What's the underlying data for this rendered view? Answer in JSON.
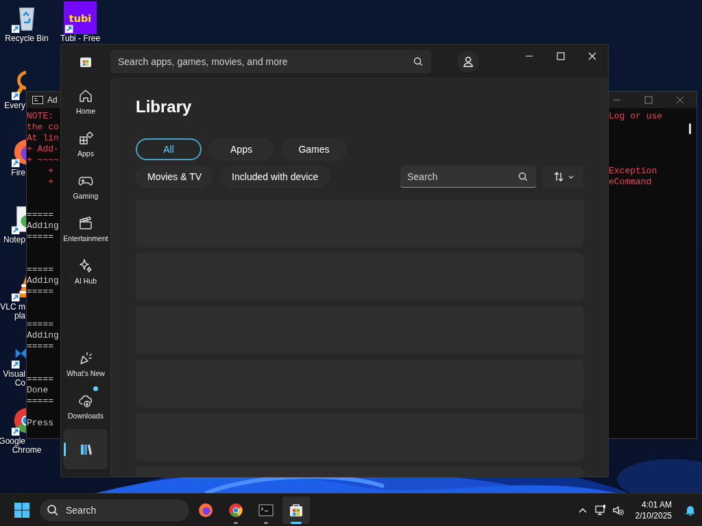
{
  "desktop_icons": [
    {
      "kind": "recycle",
      "label_lines": [
        "Recycle Bin"
      ]
    },
    {
      "kind": "everything",
      "label_lines": [
        "Every"
      ]
    },
    {
      "kind": "firefox",
      "label_lines": [
        "Fire"
      ]
    },
    {
      "kind": "notepad",
      "label_lines": [
        "Notep"
      ]
    },
    {
      "kind": "vlc",
      "label_lines": [
        "VLC m",
        "pla"
      ]
    },
    {
      "kind": "vscode",
      "label_lines": [
        "Visual",
        "Co"
      ]
    },
    {
      "kind": "chrome",
      "label_lines": [
        "Google",
        "Chrome"
      ]
    },
    {
      "kind": "tubi",
      "logo_text": "tubi",
      "label_lines": [
        "Tubi - Free"
      ]
    }
  ],
  "terminal": {
    "title": "Ad",
    "lines": [
      {
        "kind": "error",
        "left": "NOTE:",
        "right": "Log or use"
      },
      {
        "kind": "error",
        "left": "the co"
      },
      {
        "kind": "error",
        "left": "At lin"
      },
      {
        "kind": "error",
        "left": "+ Add-"
      },
      {
        "kind": "error",
        "left": "+ ~~~~"
      },
      {
        "kind": "error",
        "left": "    +",
        "right": "Exception"
      },
      {
        "kind": "error",
        "left": "    +",
        "right": "eCommand"
      },
      {
        "kind": "blank"
      },
      {
        "kind": "blank"
      },
      {
        "kind": "output",
        "left": "====="
      },
      {
        "kind": "output",
        "left": "Adding"
      },
      {
        "kind": "output",
        "left": "====="
      },
      {
        "kind": "blank"
      },
      {
        "kind": "blank"
      },
      {
        "kind": "output",
        "left": "====="
      },
      {
        "kind": "output",
        "left": "Adding"
      },
      {
        "kind": "output",
        "left": "====="
      },
      {
        "kind": "blank"
      },
      {
        "kind": "blank"
      },
      {
        "kind": "output",
        "left": "====="
      },
      {
        "kind": "output",
        "left": "Adding"
      },
      {
        "kind": "output",
        "left": "====="
      },
      {
        "kind": "blank"
      },
      {
        "kind": "blank"
      },
      {
        "kind": "output",
        "left": "====="
      },
      {
        "kind": "output",
        "left": "Done"
      },
      {
        "kind": "output",
        "left": "====="
      },
      {
        "kind": "blank"
      },
      {
        "kind": "output",
        "left": "Press"
      }
    ]
  },
  "store": {
    "search": {
      "placeholder": "Search apps, games, movies, and more"
    },
    "sidebar": {
      "items": [
        {
          "kind": "home",
          "label": "Home",
          "selected": false,
          "badge": false
        },
        {
          "kind": "apps",
          "label": "Apps",
          "selected": false,
          "badge": false
        },
        {
          "kind": "gaming",
          "label": "Gaming",
          "selected": false,
          "badge": false
        },
        {
          "kind": "entertainment",
          "label": "Entertainment",
          "selected": false,
          "badge": false
        },
        {
          "kind": "ai",
          "label": "AI Hub",
          "selected": false,
          "badge": false
        },
        {
          "kind": "whatsnew",
          "label": "What's New",
          "selected": false,
          "badge": false
        },
        {
          "kind": "downloads",
          "label": "Downloads",
          "selected": false,
          "badge": true
        },
        {
          "kind": "library",
          "selected": true,
          "badge": false
        }
      ]
    },
    "heading": "Library",
    "filters": [
      {
        "label": "All",
        "selected": true
      },
      {
        "label": "Apps",
        "selected": false
      },
      {
        "label": "Games",
        "selected": false
      },
      {
        "label": "Movies & TV",
        "selected": false
      },
      {
        "label": "Included with device",
        "selected": false
      }
    ],
    "library_search": {
      "placeholder": "Search"
    },
    "cards": [
      {
        "kind": "placeholder"
      },
      {
        "kind": "placeholder"
      },
      {
        "kind": "placeholder"
      },
      {
        "kind": "placeholder"
      },
      {
        "kind": "placeholder"
      },
      {
        "kind": "placeholder"
      }
    ]
  },
  "taskbar": {
    "search": {
      "placeholder": "Search"
    },
    "apps": [
      {
        "kind": "firefox",
        "running": false,
        "active": false
      },
      {
        "kind": "chrome",
        "running": true,
        "active": false
      },
      {
        "kind": "terminal",
        "running": true,
        "active": false
      },
      {
        "kind": "store",
        "running": true,
        "active": true
      }
    ],
    "time": "4:01 AM",
    "date": "2/10/2025"
  }
}
